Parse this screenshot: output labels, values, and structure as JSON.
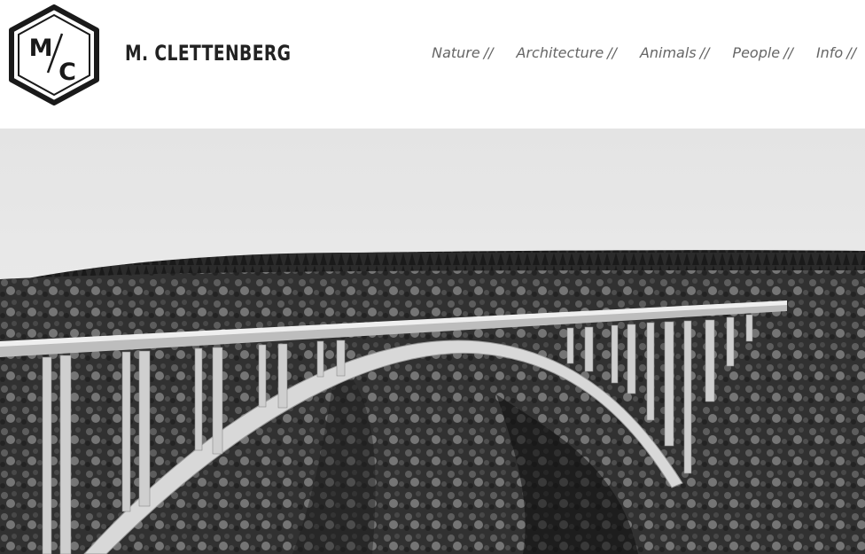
{
  "site": {
    "logo_text_top": "M",
    "logo_text_bottom": "C",
    "title": "M. CLETTENBERG"
  },
  "nav": {
    "items": [
      {
        "label": "Nature",
        "sep": "//"
      },
      {
        "label": "Architecture",
        "sep": "//"
      },
      {
        "label": "Animals",
        "sep": "//"
      },
      {
        "label": "People",
        "sep": "//"
      },
      {
        "label": "Info",
        "sep": "//"
      }
    ]
  },
  "hero": {
    "image": "arch-bridge-over-gorge-photo"
  },
  "colors": {
    "title": "#222222",
    "nav": "#666666",
    "logo": "#1a1a1a"
  }
}
